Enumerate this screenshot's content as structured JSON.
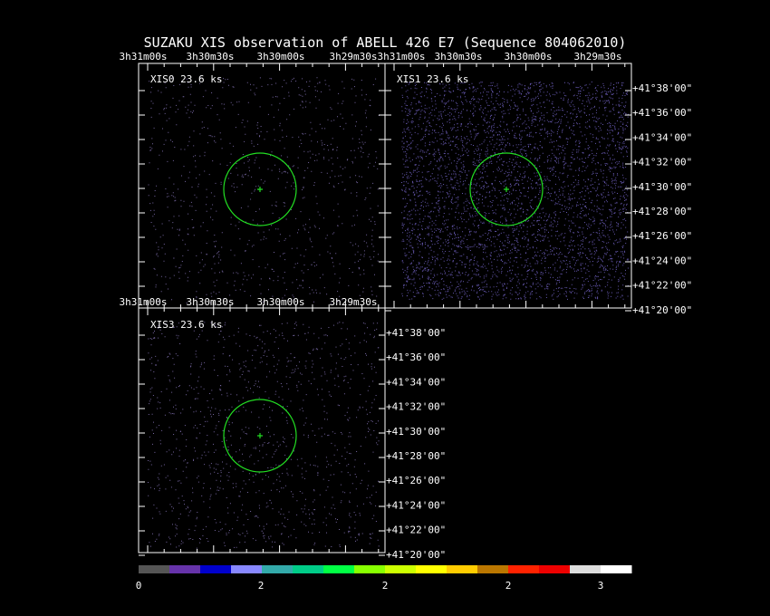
{
  "title": "SUZAKU XIS observation of ABELL 426 E7  (Sequence 804062010)",
  "panels": [
    {
      "id": "xis0",
      "label": "XIS0 23.6 ks"
    },
    {
      "id": "xis1",
      "label": "XIS1 23.6 ks"
    },
    {
      "id": "xis3",
      "label": "XIS3 23.6 ks"
    }
  ],
  "ra_ticks": [
    "3h31m00s",
    "3h30m30s",
    "3h30m00s",
    "3h29m30s"
  ],
  "dec_ticks": [
    "+41°38'00\"",
    "+41°36'00\"",
    "+41°34'00\"",
    "+41°32'00\"",
    "+41°30'00\"",
    "+41°28'00\"",
    "+41°26'00\"",
    "+41°24'00\"",
    "+41°22'00\"",
    "+41°20'00\""
  ],
  "colorbar": {
    "colors": [
      "#555555",
      "#6633aa",
      "#0000cc",
      "#8888ff",
      "#33aaaa",
      "#00cc88",
      "#00ff44",
      "#88ff00",
      "#ccff00",
      "#ffff00",
      "#ffcc00",
      "#bb7700",
      "#ff2200",
      "#ee0000",
      "#dddddd",
      "#ffffff"
    ],
    "ticks": [
      "0",
      "2",
      "2",
      "2",
      "3"
    ]
  },
  "colors": {
    "region": "#22dd22",
    "frame": "#ffffff",
    "background": "#000000"
  }
}
